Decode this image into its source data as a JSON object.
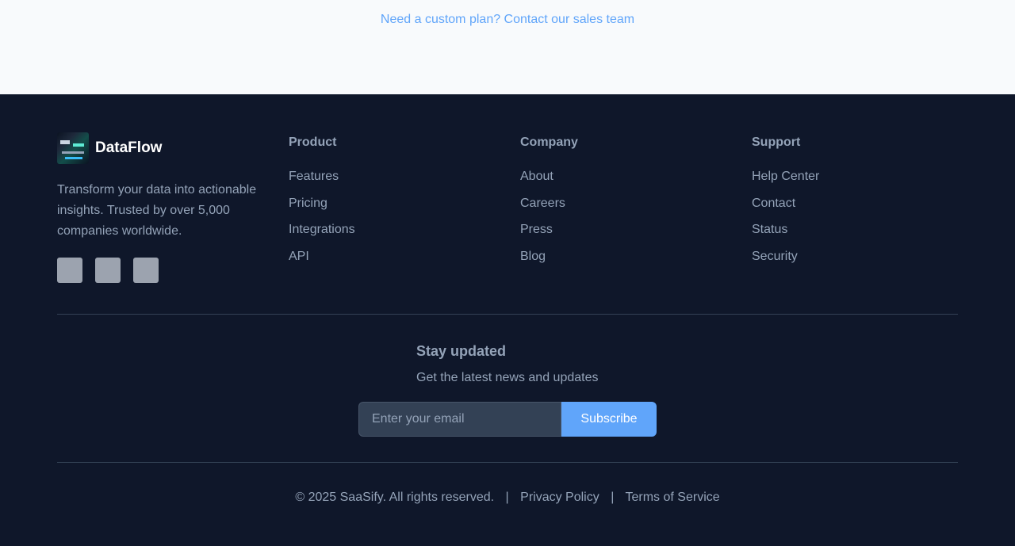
{
  "cta": {
    "prefix": "Need a ",
    "custom": "custom",
    "middle": " plan? Contact our sales ",
    "team": "team"
  },
  "brand": {
    "name": "DataFlow",
    "description": "Transform your data into actionable insights. Trusted by over 5,000 companies worldwide.",
    "logo_icon": "dataflow-logo",
    "socials": [
      "social-icon-1",
      "social-icon-2",
      "social-icon-3"
    ]
  },
  "columns": [
    {
      "title": "Product",
      "links": [
        "Features",
        "Pricing",
        "Integrations",
        "API"
      ]
    },
    {
      "title": "Company",
      "links": [
        "About",
        "Careers",
        "Press",
        "Blog"
      ]
    },
    {
      "title": "Support",
      "links": [
        "Help Center",
        "Contact",
        "Status",
        "Security"
      ]
    }
  ],
  "newsletter": {
    "title": "Stay updated",
    "subtitle": "Get the latest news and updates",
    "email_placeholder": "Enter your email",
    "button_label": "Subscribe"
  },
  "bottom": {
    "copyright": "© 2025 SaaSify. All rights reserved.",
    "separator": "|",
    "privacy": "Privacy Policy",
    "terms": "Terms of Service"
  },
  "colors": {
    "footer_bg": "#0f172a",
    "top_bg": "#f8fafc",
    "accent": "#60a5fa"
  }
}
